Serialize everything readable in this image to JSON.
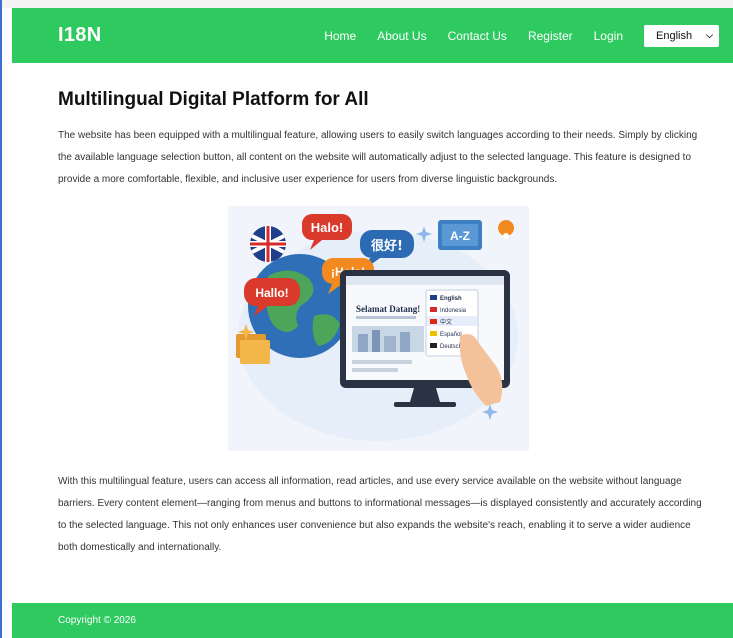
{
  "header": {
    "brand": "I18N",
    "nav": [
      "Home",
      "About Us",
      "Contact Us",
      "Register",
      "Login"
    ],
    "language_select": {
      "selected": "English"
    }
  },
  "main": {
    "title": "Multilingual Digital Platform for All",
    "intro": "The website has been equipped with a multilingual feature, allowing users to easily switch languages according to their needs. Simply by clicking the available language selection button, all content on the website will automatically adjust to the selected language. This feature is designed to provide a more comfortable, flexible, and inclusive user experience for users from diverse linguistic backgrounds.",
    "illustration": {
      "bubbles": [
        "Halo!",
        "很好!",
        "¡Hola!",
        "Hallo!"
      ],
      "book_label": "A-Z",
      "screen_greeting": "Selamat Datang!",
      "menu_items": [
        "English",
        "Indonesia",
        "中文",
        "Español",
        "Deutsch"
      ]
    },
    "body": "With this multilingual feature, users can access all information, read articles, and use every service available on the website without language barriers. Every content element—ranging from menus and buttons to informational messages—is displayed consistently and accurately according to the selected language. This not only enhances user convenience but also expands the website's reach, enabling it to serve a wider audience both domestically and internationally."
  },
  "footer": {
    "copyright": "Copyright © 2026"
  },
  "colors": {
    "primary": "#2ec95f",
    "accent_bubble_red": "#d93a2b",
    "accent_bubble_blue": "#2c6bb4",
    "accent_bubble_orange": "#f28a1f"
  }
}
